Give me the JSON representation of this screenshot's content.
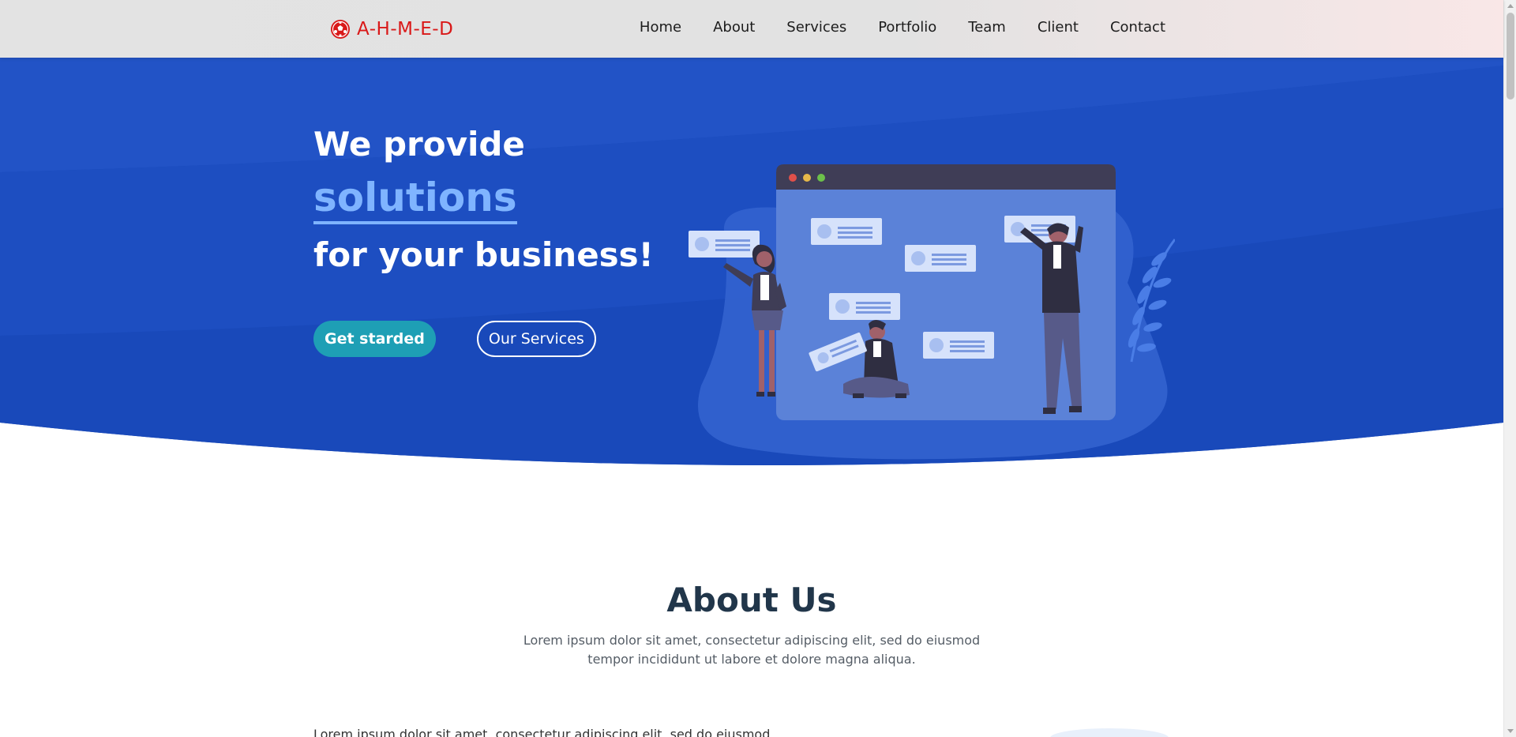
{
  "header": {
    "logo_icon": "soccer-ball-icon",
    "logo_text": "A-H-M-E-D",
    "nav": [
      "Home",
      "About",
      "Services",
      "Portfolio",
      "Team",
      "Client",
      "Contact"
    ]
  },
  "hero": {
    "line1": "We provide",
    "line2": "solutions",
    "line3": "for your business!",
    "cta_primary": "Get starded",
    "cta_secondary": "Our Services"
  },
  "about": {
    "title": "About Us",
    "description": "Lorem ipsum dolor sit amet, consectetur adipiscing elit, sed do eiusmod tempor incididunt ut labore et dolore magna aliqua.",
    "snippet": "Lorem ipsum dolor sit amet, consectetur adipiscing elit, sed do eiusmod"
  },
  "colors": {
    "brand_red": "#d91919",
    "hero_blue": "#1e4fc1",
    "accent_light_blue": "#7fb4ff",
    "button_teal": "#1e9fb5",
    "heading_dark": "#21364a"
  }
}
